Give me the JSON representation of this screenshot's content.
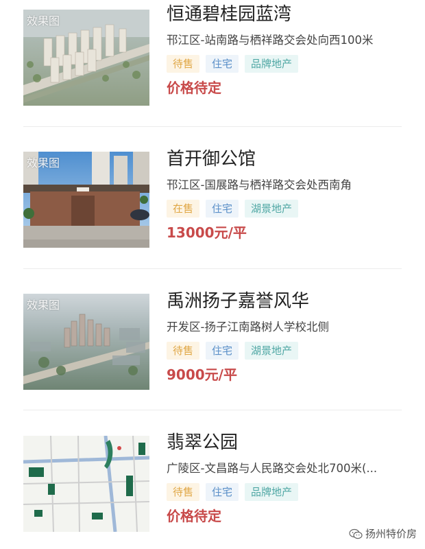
{
  "thumbnail_watermark": "效果图",
  "listings": [
    {
      "name": "恒通碧桂园蓝湾",
      "address": "邗江区-站南路与栖祥路交会处向西100米",
      "tags": [
        "待售",
        "住宅",
        "品牌地产"
      ],
      "price": "价格待定",
      "thumbnail": "aerial-residential-render"
    },
    {
      "name": "首开御公馆",
      "address": "邗江区-国展路与栖祥路交会处西南角",
      "tags": [
        "在售",
        "住宅",
        "湖景地产"
      ],
      "price": "13000元/平",
      "thumbnail": "gate-entrance-render"
    },
    {
      "name": "禹洲扬子嘉誉风华",
      "address": "开发区-扬子江南路树人学校北侧",
      "tags": [
        "待售",
        "住宅",
        "湖景地产"
      ],
      "price": "9000元/平",
      "thumbnail": "aerial-city-render"
    },
    {
      "name": "翡翠公园",
      "address": "广陵区-文昌路与人民路交会处北700米(...",
      "tags": [
        "待售",
        "住宅",
        "品牌地产"
      ],
      "price": "价格待定",
      "thumbnail": "location-map"
    }
  ],
  "brand": {
    "label": "扬州特价房",
    "icon": "wechat-icon"
  },
  "colors": {
    "price": "#c84a4a",
    "tag_status": "#e0a746",
    "tag_type": "#5a8fc8",
    "tag_feature": "#4fa7a4"
  }
}
